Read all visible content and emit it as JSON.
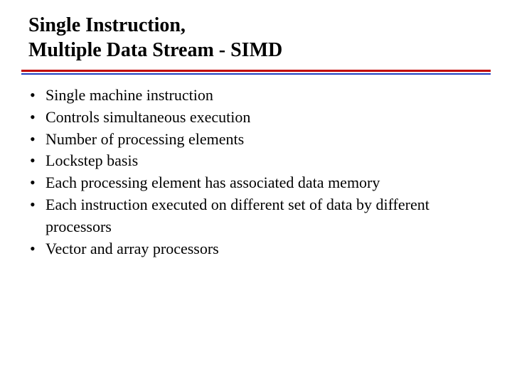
{
  "title_line1": "Single Instruction,",
  "title_line2": "Multiple Data Stream - SIMD",
  "bullets": [
    "Single machine instruction",
    "Controls simultaneous execution",
    "Number of processing elements",
    "Lockstep basis",
    "Each processing element has associated data memory",
    "Each instruction executed on different set of data by different processors",
    "Vector and array processors"
  ]
}
